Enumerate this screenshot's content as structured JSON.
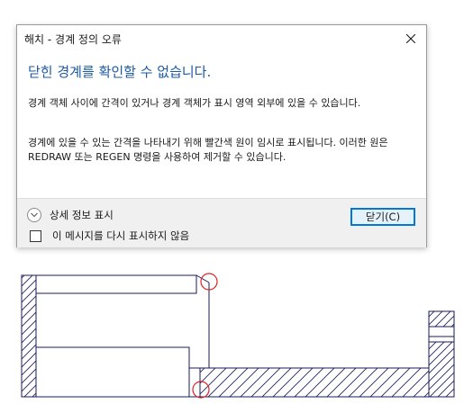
{
  "dialog": {
    "title": "해치 - 경계 정의 오류",
    "main_instruction": "닫힌 경계를 확인할 수 없습니다.",
    "paragraph_1": "경계 객체 사이에 간격이 있거나 경계 객체가 표시 영역 외부에 있을 수 있습니다.",
    "paragraph_2": "경계에 있을 수 있는 간격을 나타내기 위해 빨간색 원이 임시로 표시됩니다. 이러한 원은 REDRAW 또는 REGEN 명령을 사용하여 제거할 수 있습니다.",
    "details_label": "상세 정보 표시",
    "checkbox_label": "이 메시지를 다시 표시하지 않음",
    "checkbox_checked": false,
    "close_button_label": "닫기(C)"
  },
  "colors": {
    "instruction_blue": "#1c5aa6",
    "drawing_lines": "#1a1a5c",
    "gap_circle": "#e02020",
    "footer_bg": "#f0f0f0",
    "button_accent": "#0078d7"
  },
  "icons": {
    "close": "close-icon",
    "expander": "chevron-down-icon",
    "gap_marker": "red-circle-marker"
  }
}
